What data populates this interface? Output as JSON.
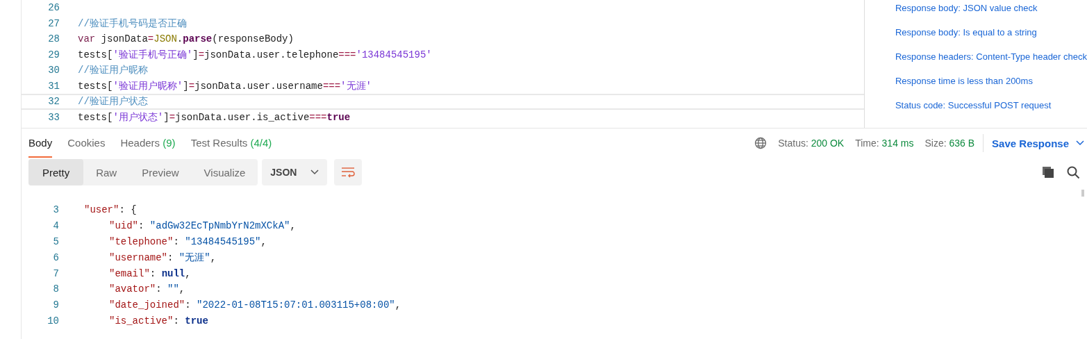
{
  "editor": {
    "lines": [
      {
        "number": "26",
        "current": false
      },
      {
        "number": "27",
        "current": false,
        "tokens": [
          {
            "kind": "comment",
            "text": "//验证手机号码是否正确"
          }
        ]
      },
      {
        "number": "28",
        "current": false,
        "tokens": [
          {
            "kind": "keyword",
            "text": "var"
          },
          {
            "kind": "plain",
            "text": " jsonData"
          },
          {
            "kind": "operator",
            "text": "="
          },
          {
            "kind": "builtin",
            "text": "JSON"
          },
          {
            "kind": "plain",
            "text": "."
          },
          {
            "kind": "method",
            "text": "parse"
          },
          {
            "kind": "plain",
            "text": "(responseBody)"
          }
        ]
      },
      {
        "number": "29",
        "current": false,
        "tokens": [
          {
            "kind": "plain",
            "text": "tests["
          },
          {
            "kind": "string",
            "text": "'验证手机号正确'"
          },
          {
            "kind": "plain",
            "text": "]"
          },
          {
            "kind": "operator",
            "text": "="
          },
          {
            "kind": "plain",
            "text": "jsonData.user.telephone"
          },
          {
            "kind": "operator",
            "text": "==="
          },
          {
            "kind": "string",
            "text": "'13484545195'"
          }
        ]
      },
      {
        "number": "30",
        "current": false,
        "tokens": [
          {
            "kind": "comment",
            "text": "//验证用户昵称"
          }
        ]
      },
      {
        "number": "31",
        "current": false,
        "tokens": [
          {
            "kind": "plain",
            "text": "tests["
          },
          {
            "kind": "string",
            "text": "'验证用户昵称'"
          },
          {
            "kind": "plain",
            "text": "]"
          },
          {
            "kind": "operator",
            "text": "="
          },
          {
            "kind": "plain",
            "text": "jsonData.user.username"
          },
          {
            "kind": "operator",
            "text": "==="
          },
          {
            "kind": "string",
            "text": "'无涯'"
          }
        ]
      },
      {
        "number": "32",
        "current": true,
        "tokens": [
          {
            "kind": "comment",
            "text": "//验证用户状态"
          }
        ]
      },
      {
        "number": "33",
        "current": false,
        "tokens": [
          {
            "kind": "plain",
            "text": "tests["
          },
          {
            "kind": "string",
            "text": "'用户状态'"
          },
          {
            "kind": "plain",
            "text": "]"
          },
          {
            "kind": "operator",
            "text": "="
          },
          {
            "kind": "plain",
            "text": "jsonData.user.is_active"
          },
          {
            "kind": "operator",
            "text": "==="
          },
          {
            "kind": "method",
            "text": "true"
          }
        ]
      }
    ]
  },
  "snippets": [
    "Response body: JSON value check",
    "Response body: Is equal to a string",
    "Response headers: Content-Type header check",
    "Response time is less than 200ms",
    "Status code: Successful POST request"
  ],
  "response_tabs": [
    {
      "label": "Body",
      "selected": true
    },
    {
      "label": "Cookies",
      "selected": false
    },
    {
      "label": "Headers",
      "count": "(9)",
      "selected": false
    },
    {
      "label": "Test Results",
      "count": "(4/4)",
      "selected": false
    }
  ],
  "status": [
    {
      "label": "Status:",
      "value": "200 OK"
    },
    {
      "label": "Time:",
      "value": "314 ms"
    },
    {
      "label": "Size:",
      "value": "636 B"
    }
  ],
  "save_button": "Save Response",
  "view_modes": [
    {
      "label": "Pretty",
      "selected": true
    },
    {
      "label": "Raw",
      "selected": false
    },
    {
      "label": "Preview",
      "selected": false
    },
    {
      "label": "Visualize",
      "selected": false
    }
  ],
  "format_select": "JSON",
  "body": {
    "lines": [
      {
        "number": "3",
        "tokens": [
          {
            "kind": "key",
            "text": "\"user\""
          },
          {
            "kind": "punct",
            "text": ": {"
          }
        ],
        "children": [
          {
            "number": "4",
            "tokens": [
              {
                "kind": "key",
                "text": "\"uid\""
              },
              {
                "kind": "punct",
                "text": ": "
              },
              {
                "kind": "string",
                "text": "\"adGw32EcTpNmbYrN2mXCkA\""
              },
              {
                "kind": "punct",
                "text": ","
              }
            ]
          },
          {
            "number": "5",
            "tokens": [
              {
                "kind": "key",
                "text": "\"telephone\""
              },
              {
                "kind": "punct",
                "text": ": "
              },
              {
                "kind": "string",
                "text": "\"13484545195\""
              },
              {
                "kind": "punct",
                "text": ","
              }
            ]
          },
          {
            "number": "6",
            "tokens": [
              {
                "kind": "key",
                "text": "\"username\""
              },
              {
                "kind": "punct",
                "text": ": "
              },
              {
                "kind": "string",
                "text": "\"无涯\""
              },
              {
                "kind": "punct",
                "text": ","
              }
            ]
          },
          {
            "number": "7",
            "tokens": [
              {
                "kind": "key",
                "text": "\"email\""
              },
              {
                "kind": "punct",
                "text": ": "
              },
              {
                "kind": "literal",
                "text": "null"
              },
              {
                "kind": "punct",
                "text": ","
              }
            ]
          },
          {
            "number": "8",
            "tokens": [
              {
                "kind": "key",
                "text": "\"avator\""
              },
              {
                "kind": "punct",
                "text": ": "
              },
              {
                "kind": "string",
                "text": "\"\""
              },
              {
                "kind": "punct",
                "text": ","
              }
            ]
          },
          {
            "number": "9",
            "tokens": [
              {
                "kind": "key",
                "text": "\"date_joined\""
              },
              {
                "kind": "punct",
                "text": ": "
              },
              {
                "kind": "string",
                "text": "\"2022-01-08T15:07:01.003115+08:00\""
              },
              {
                "kind": "punct",
                "text": ","
              }
            ]
          },
          {
            "number": "10",
            "tokens": [
              {
                "kind": "key",
                "text": "\"is_active\""
              },
              {
                "kind": "punct",
                "text": ": "
              },
              {
                "kind": "literal",
                "text": "true"
              }
            ]
          }
        ]
      }
    ]
  }
}
